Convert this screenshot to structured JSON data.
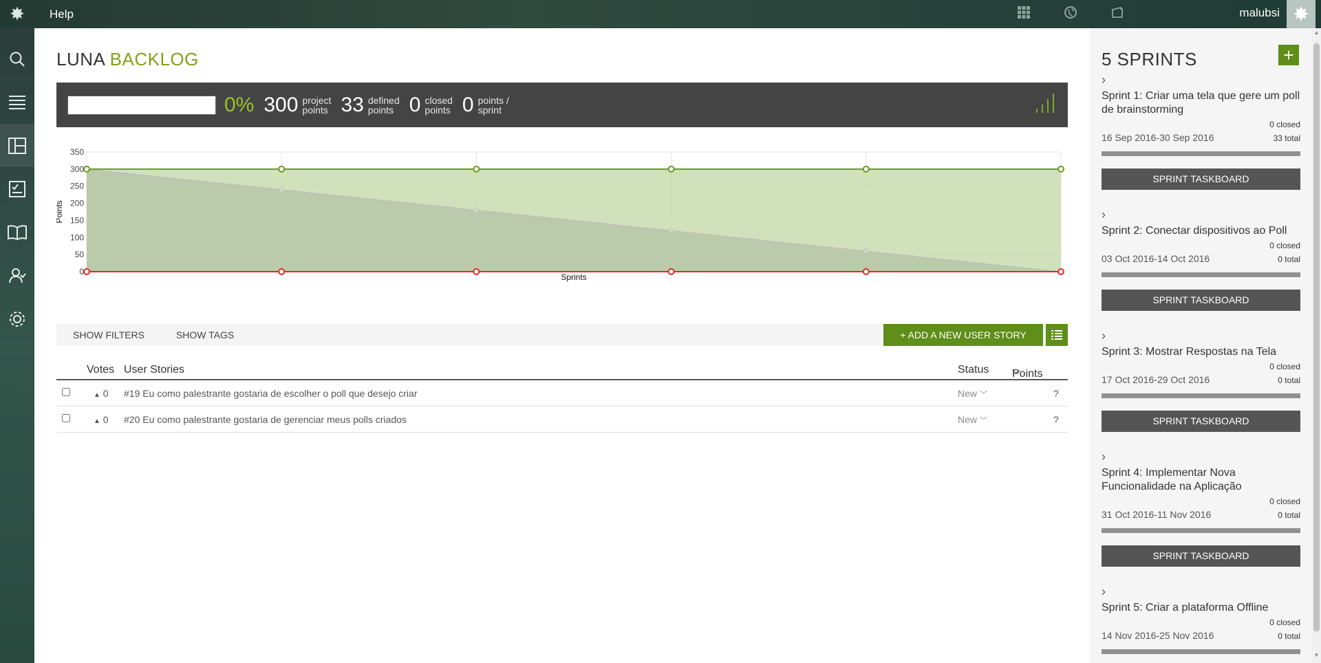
{
  "topbar": {
    "help_label": "Help",
    "username": "malubsi",
    "icons": [
      "apps-grid-icon",
      "globe-icon",
      "briefcase-icon"
    ]
  },
  "leftnav": {
    "items": [
      "search-icon",
      "backlog-list-icon",
      "kanban-icon",
      "issues-check-icon",
      "wiki-book-icon",
      "team-icon",
      "admin-gear-icon"
    ]
  },
  "page": {
    "title_main": "LUNA",
    "title_accent": "BACKLOG"
  },
  "stats": {
    "percent": "0%",
    "project_points": "300",
    "project_points_label_1": "project",
    "project_points_label_2": "points",
    "defined_points": "33",
    "defined_points_label_1": "defined",
    "defined_points_label_2": "points",
    "closed_points": "0",
    "closed_points_label_1": "closed",
    "closed_points_label_2": "points",
    "points_per_sprint": "0",
    "pps_label_1": "points /",
    "pps_label_2": "sprint"
  },
  "chart_data": {
    "type": "area",
    "xlabel": "Sprints",
    "ylabel": "Points",
    "ylim": [
      0,
      350
    ],
    "yticks": [
      0,
      50,
      100,
      150,
      200,
      250,
      300,
      350
    ],
    "x": [
      0,
      1,
      2,
      3,
      4,
      5
    ],
    "series": [
      {
        "name": "",
        "values": [
          300,
          300,
          300,
          300,
          300,
          300
        ],
        "color": "#6a9a1e"
      },
      {
        "name": "",
        "values": [
          300,
          240,
          180,
          120,
          60,
          0
        ],
        "color": "#bbbbbb"
      },
      {
        "name": "",
        "values": [
          0,
          0,
          0,
          0,
          0,
          0
        ],
        "color": "#ee2222"
      }
    ],
    "grid": true
  },
  "filters": {
    "show_filters": "SHOW FILTERS",
    "show_tags": "SHOW TAGS",
    "add_story": "+ ADD A NEW USER STORY"
  },
  "table": {
    "headers": {
      "votes": "Votes",
      "stories": "User Stories",
      "status": "Status",
      "points": "Points"
    },
    "rows": [
      {
        "votes": "0",
        "story": "#19 Eu como palestrante gostaria de escolher o poll que desejo criar",
        "status": "New",
        "points": "?"
      },
      {
        "votes": "0",
        "story": "#20 Eu como palestrante gostaria de gerenciar meus polls criados",
        "status": "New",
        "points": "?"
      }
    ]
  },
  "sprints_panel": {
    "title": "5 SPRINTS",
    "add_label": "+",
    "button_label": "SPRINT TASKBOARD",
    "sprints": [
      {
        "name": "Sprint 1: Criar uma tela que gere um poll de brainstorming",
        "closed": "0 closed",
        "dates": "16 Sep 2016-30 Sep 2016",
        "total": "33 total",
        "progress": 0
      },
      {
        "name": "Sprint 2: Conectar dispositivos ao Poll",
        "closed": "0 closed",
        "dates": "03 Oct 2016-14 Oct 2016",
        "total": "0 total",
        "progress": 0
      },
      {
        "name": "Sprint 3: Mostrar Respostas na Tela",
        "closed": "0 closed",
        "dates": "17 Oct 2016-29 Oct 2016",
        "total": "0 total",
        "progress": 0
      },
      {
        "name": "Sprint 4: Implementar Nova Funcionalidade na Aplicação",
        "closed": "0 closed",
        "dates": "31 Oct 2016-11 Nov 2016",
        "total": "0 total",
        "progress": 0
      },
      {
        "name": "Sprint 5: Criar a plataforma Offline",
        "closed": "0 closed",
        "dates": "14 Nov 2016-25 Nov 2016",
        "total": "0 total",
        "progress": 0
      }
    ]
  }
}
